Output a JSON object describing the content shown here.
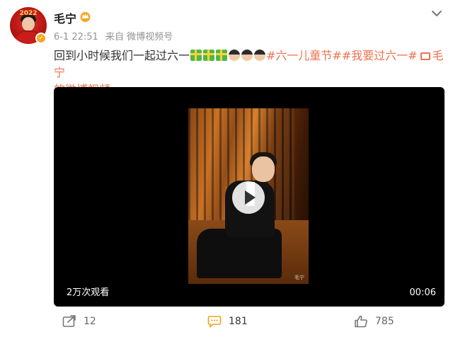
{
  "post": {
    "author": "毛宁",
    "avatar_year": "2022",
    "timestamp": "6-1 22:51",
    "source": "来自 微博视频号",
    "text_plain": "回到小时候我们一起过六一",
    "topic_1": "#六一儿童节#",
    "topic_2": "#我要过六一#",
    "link_line1": "毛宁",
    "link_line2": "的微博视频"
  },
  "video": {
    "views": "2万次观看",
    "duration": "00:06",
    "watermark": "毛宁"
  },
  "actions": {
    "repost_count": "12",
    "comment_count": "181",
    "like_count": "785"
  },
  "colors": {
    "topic": "#eb7350",
    "verify_badge": "#f6a623",
    "comment_accent": "#f0a21b"
  },
  "icons": [
    "more-icon",
    "crown-icon",
    "verify-icon",
    "gift-emoji",
    "doll-emoji",
    "video-link-icon",
    "play-icon",
    "repost-icon",
    "comment-icon",
    "like-icon"
  ]
}
